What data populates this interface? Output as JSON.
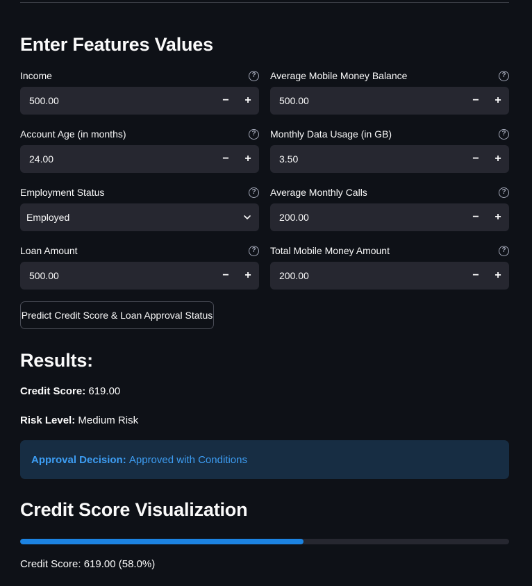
{
  "header": {
    "title": "Enter Features Values"
  },
  "fields": [
    {
      "label": "Income",
      "value": "500.00",
      "kind": "number",
      "help_icon": "question-circle-icon"
    },
    {
      "label": "Average Mobile Money Balance",
      "value": "500.00",
      "kind": "number",
      "help_icon": "question-circle-icon"
    },
    {
      "label": "Account Age (in months)",
      "value": "24.00",
      "kind": "number",
      "help_icon": "question-circle-icon"
    },
    {
      "label": "Monthly Data Usage (in GB)",
      "value": "3.50",
      "kind": "number",
      "help_icon": "question-circle-icon"
    },
    {
      "label": "Employment Status",
      "value": "Employed",
      "kind": "select",
      "help_icon": "question-circle-icon"
    },
    {
      "label": "Average Monthly Calls",
      "value": "200.00",
      "kind": "number",
      "help_icon": "question-circle-icon"
    },
    {
      "label": "Loan Amount",
      "value": "500.00",
      "kind": "number",
      "help_icon": "question-circle-icon"
    },
    {
      "label": "Total Mobile Money Amount",
      "value": "200.00",
      "kind": "number",
      "help_icon": "question-circle-icon"
    }
  ],
  "stepper": {
    "minus": "−",
    "plus": "+"
  },
  "help_glyph": "?",
  "predict_button": {
    "label": "Predict Credit Score & Loan Approval Status"
  },
  "results": {
    "title": "Results:",
    "credit_score_label": "Credit Score:",
    "credit_score_value": "619.00",
    "risk_level_label": "Risk Level:",
    "risk_level_value": "Medium Risk",
    "approval_label": "Approval Decision:",
    "approval_value": "Approved with Conditions"
  },
  "visualization": {
    "title": "Credit Score Visualization",
    "progress_fraction": 0.58,
    "progress_label": "Credit Score: 619.00 (58.0%)"
  },
  "colors": {
    "background": "#0e1117",
    "input_bg": "#262730",
    "accent": "#1c83e1",
    "info_bg": "#172d43",
    "info_text": "#3d9df3"
  }
}
